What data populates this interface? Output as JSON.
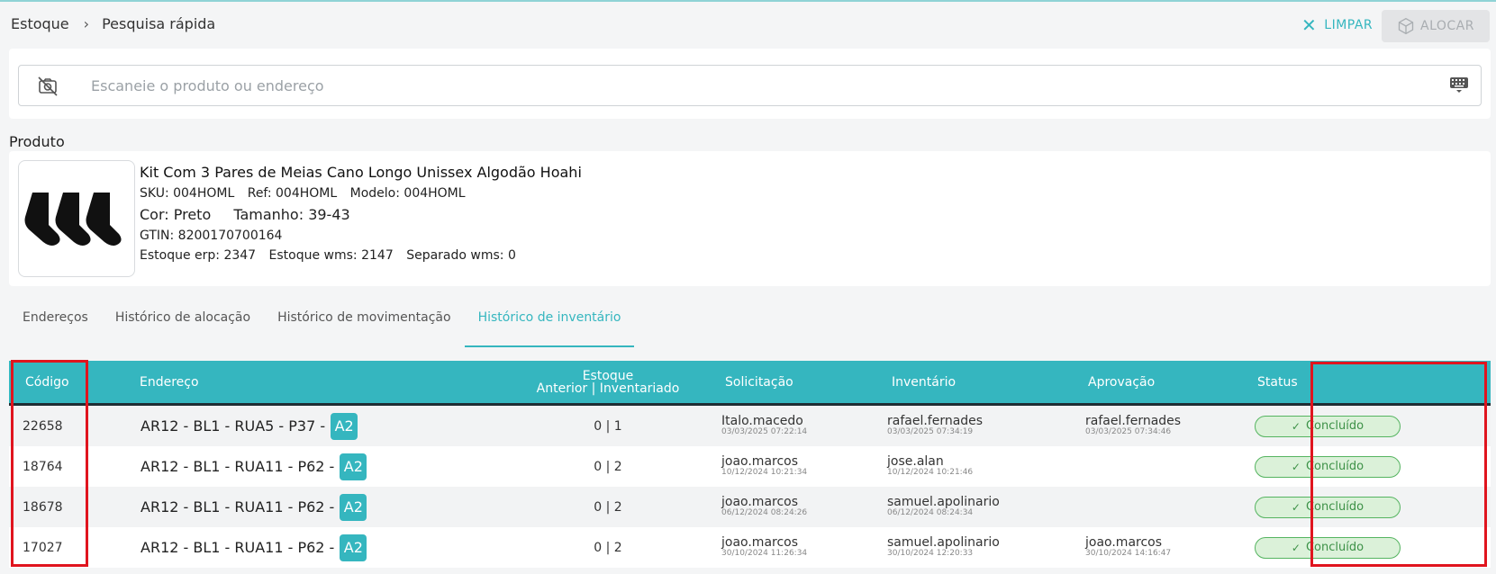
{
  "breadcrumb": [
    "Estoque",
    "Pesquisa rápida"
  ],
  "actions": {
    "limpar": "LIMPAR",
    "alocar": "ALOCAR"
  },
  "search": {
    "placeholder": "Escaneie o produto ou endereço",
    "value": ""
  },
  "product": {
    "section_title": "Produto",
    "name": "Kit Com 3 Pares de Meias Cano Longo Unissex Algodão Hoahi",
    "sku": "SKU: 004HOML",
    "ref": "Ref: 004HOML",
    "modelo": "Modelo: 004HOML",
    "cor": "Cor: Preto",
    "tamanho": "Tamanho: 39-43",
    "gtin": "GTIN: 8200170700164",
    "estoque_erp": "Estoque erp: 2347",
    "estoque_wms": "Estoque wms: 2147",
    "separado_wms": "Separado wms: 0"
  },
  "tabs": [
    "Endereços",
    "Histórico de alocação",
    "Histórico de movimentação",
    "Histórico de inventário"
  ],
  "active_tab": "Histórico de inventário",
  "table": {
    "headers": {
      "codigo": "Código",
      "endereco": "Endereço",
      "estoque_line1": "Estoque",
      "estoque_line2": "Anterior | Inventariado",
      "solicitacao": "Solicitação",
      "inventario": "Inventário",
      "aprovacao": "Aprovação",
      "status": "Status"
    },
    "rows": [
      {
        "codigo": "22658",
        "endereco": "AR12 - BL1 - RUA5 - P37 -",
        "tag": "A2",
        "estoque": "0 | 1",
        "sol_user": "Italo.macedo",
        "sol_date": "03/03/2025 07:22:14",
        "inv_user": "rafael.fernades",
        "inv_date": "03/03/2025 07:34:19",
        "apr_user": "rafael.fernades",
        "apr_date": "03/03/2025 07:34:46",
        "status": "Concluído"
      },
      {
        "codigo": "18764",
        "endereco": "AR12 - BL1 - RUA11 - P62 -",
        "tag": "A2",
        "estoque": "0 | 2",
        "sol_user": "joao.marcos",
        "sol_date": "10/12/2024 10:21:34",
        "inv_user": "jose.alan",
        "inv_date": "10/12/2024 10:21:46",
        "apr_user": "",
        "apr_date": "",
        "status": "Concluído"
      },
      {
        "codigo": "18678",
        "endereco": "AR12 - BL1 - RUA11 - P62 -",
        "tag": "A2",
        "estoque": "0 | 2",
        "sol_user": "joao.marcos",
        "sol_date": "06/12/2024 08:24:26",
        "inv_user": "samuel.apolinario",
        "inv_date": "06/12/2024 08:24:34",
        "apr_user": "",
        "apr_date": "",
        "status": "Concluído"
      },
      {
        "codigo": "17027",
        "endereco": "AR12 - BL1 - RUA11 - P62 -",
        "tag": "A2",
        "estoque": "0 | 2",
        "sol_user": "joao.marcos",
        "sol_date": "30/10/2024 11:26:34",
        "inv_user": "samuel.apolinario",
        "inv_date": "30/10/2024 12:20:33",
        "apr_user": "joao.marcos",
        "apr_date": "30/10/2024 14:16:47",
        "status": "Concluído"
      }
    ]
  },
  "colors": {
    "accent": "#35b6bf",
    "status_green": "#3d9147",
    "highlight_red": "#e0141e"
  }
}
